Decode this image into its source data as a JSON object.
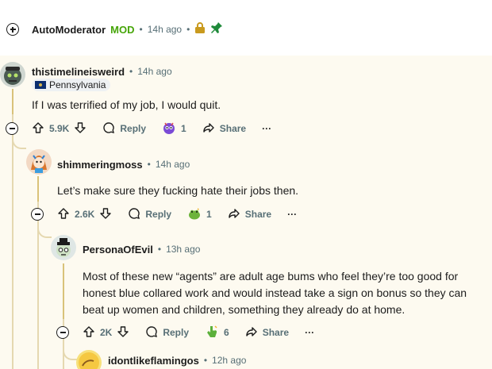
{
  "automod": {
    "author": "AutoModerator",
    "badge": "MOD",
    "time": "14h ago"
  },
  "comments": [
    {
      "author": "thistimelineisweird",
      "time": "14h ago",
      "flair": "Pennsylvania",
      "body": "If I was terrified of my job, I would quit.",
      "votes": "5.9K",
      "reply_label": "Reply",
      "award_count": "1",
      "share_label": "Share",
      "more_label": "···"
    },
    {
      "author": "shimmeringmoss",
      "time": "14h ago",
      "body": "Let’s make sure they fucking hate their jobs then.",
      "votes": "2.6K",
      "reply_label": "Reply",
      "award_count": "1",
      "share_label": "Share",
      "more_label": "···"
    },
    {
      "author": "PersonaOfEvil",
      "time": "13h ago",
      "body_lines": [
        "Most of these new “agents” are adult age bums who feel they’re too good for",
        "honest blue collared work and would instead take a sign on bonus so they can",
        "beat up women and children, something they already do at home."
      ],
      "votes": "2K",
      "reply_label": "Reply",
      "award_count": "6",
      "share_label": "Share",
      "more_label": "···"
    },
    {
      "author": "idontlikeflamingos",
      "time": "12h ago"
    }
  ],
  "separator": "•",
  "colors": {
    "mod_green": "#46a508",
    "meta_gray": "#576f76",
    "thread_line": "#e5d8b0",
    "highlight_bg": "#fbf6e6"
  }
}
